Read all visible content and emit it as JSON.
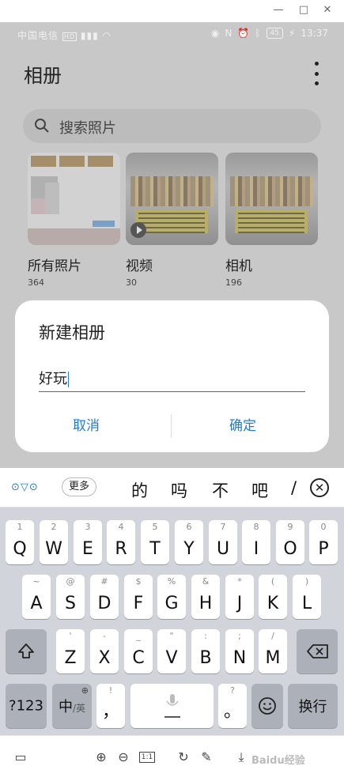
{
  "window": {
    "minimize": "—",
    "maximize": "□",
    "close": "✕"
  },
  "status_bar": {
    "carrier": "中国电信",
    "network": "HD",
    "battery": "45",
    "time": "13:37"
  },
  "gallery": {
    "title": "相册",
    "search_placeholder": "搜索照片",
    "albums": [
      {
        "name": "所有照片",
        "count": "364"
      },
      {
        "name": "视频",
        "count": "30"
      },
      {
        "name": "相机",
        "count": "196"
      }
    ]
  },
  "dialog": {
    "title": "新建相册",
    "input_value": "好玩",
    "cancel_label": "取消",
    "confirm_label": "确定"
  },
  "candidates": {
    "more_label": "更多",
    "words": [
      "的",
      "吗",
      "不",
      "吧",
      "/"
    ]
  },
  "keyboard": {
    "row1": [
      {
        "main": "Q",
        "sub": "1"
      },
      {
        "main": "W",
        "sub": "2"
      },
      {
        "main": "E",
        "sub": "3"
      },
      {
        "main": "R",
        "sub": "4"
      },
      {
        "main": "T",
        "sub": "5"
      },
      {
        "main": "Y",
        "sub": "6"
      },
      {
        "main": "U",
        "sub": "7"
      },
      {
        "main": "I",
        "sub": "8"
      },
      {
        "main": "O",
        "sub": "9"
      },
      {
        "main": "P",
        "sub": "0"
      }
    ],
    "row2": [
      {
        "main": "A",
        "sub": "~"
      },
      {
        "main": "S",
        "sub": "@"
      },
      {
        "main": "D",
        "sub": "#"
      },
      {
        "main": "F",
        "sub": "$"
      },
      {
        "main": "G",
        "sub": "%"
      },
      {
        "main": "H",
        "sub": "&"
      },
      {
        "main": "J",
        "sub": "*"
      },
      {
        "main": "K",
        "sub": "("
      },
      {
        "main": "L",
        "sub": ")"
      }
    ],
    "row3": [
      {
        "main": "Z",
        "sub": "'"
      },
      {
        "main": "X",
        "sub": "-"
      },
      {
        "main": "C",
        "sub": "_"
      },
      {
        "main": "V",
        "sub": "\""
      },
      {
        "main": "B",
        "sub": ":"
      },
      {
        "main": "N",
        "sub": ";"
      },
      {
        "main": "M",
        "sub": "/"
      }
    ],
    "num_label": "?123",
    "lang_label": "中",
    "lang_sub": "/英",
    "comma": "，",
    "comma_sub": "!",
    "period": "。",
    "period_sub": "?",
    "enter_label": "换行"
  },
  "watermark": "Baidu经验"
}
